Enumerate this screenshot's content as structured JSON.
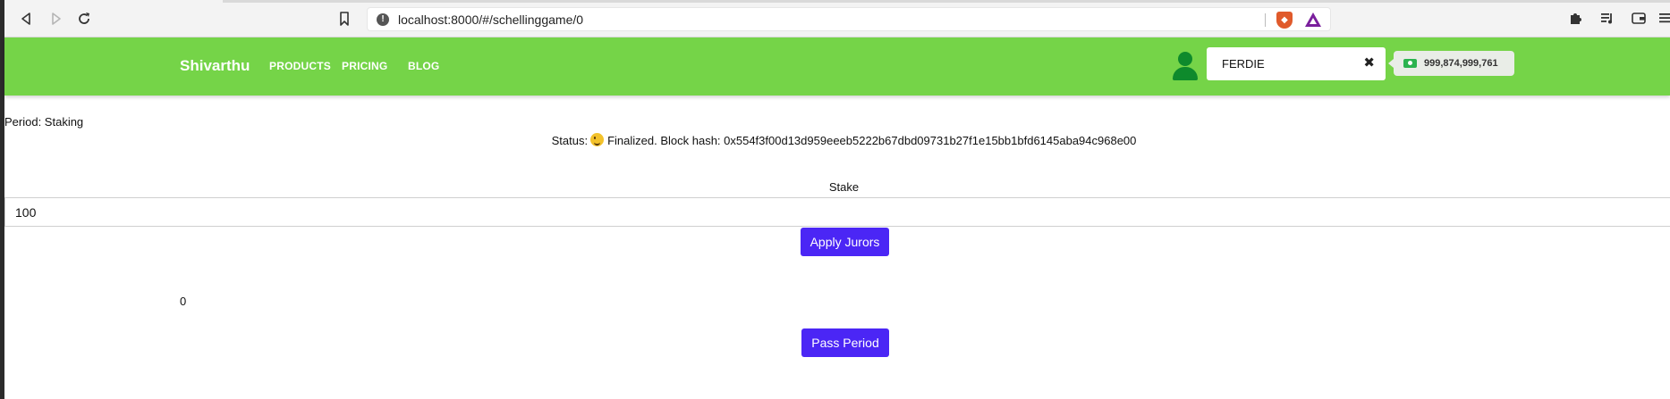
{
  "browser": {
    "url": "localhost:8000/#/schellinggame/0"
  },
  "navbar": {
    "brand": "Shivarthu",
    "links": [
      "PRODUCTS",
      "PRICING",
      "BLOG"
    ],
    "account_name": "FERDIE",
    "account_clear_icon": "✖",
    "balance": "999,874,999,761",
    "accent_color": "#75d448"
  },
  "main": {
    "period": "Period: Staking",
    "status_prefix": "Status:",
    "status_text": "Finalized. Block hash: 0x554f3f00d13d959eeeb5222b67dbd09731b27f1e15bb1bfd6145aba94c968e00",
    "stake_label": "Stake",
    "stake_value": "100",
    "apply_button": "Apply Jurors",
    "count": "0",
    "pass_button": "Pass Period",
    "button_color": "#4b26f5"
  },
  "icons": {
    "back": "back-arrow-icon",
    "forward": "forward-arrow-icon",
    "reload": "reload-icon",
    "bookmark": "bookmark-icon",
    "info": "site-info-icon",
    "brave_shield": "brave-shield-icon",
    "brave_rewards": "brave-rewards-icon",
    "extensions": "puzzle-icon",
    "playlist": "playlist-icon",
    "wallet": "wallet-icon",
    "menu": "hamburger-menu-icon",
    "user": "user-icon",
    "money": "money-icon",
    "emoji": "winking-face-icon"
  }
}
